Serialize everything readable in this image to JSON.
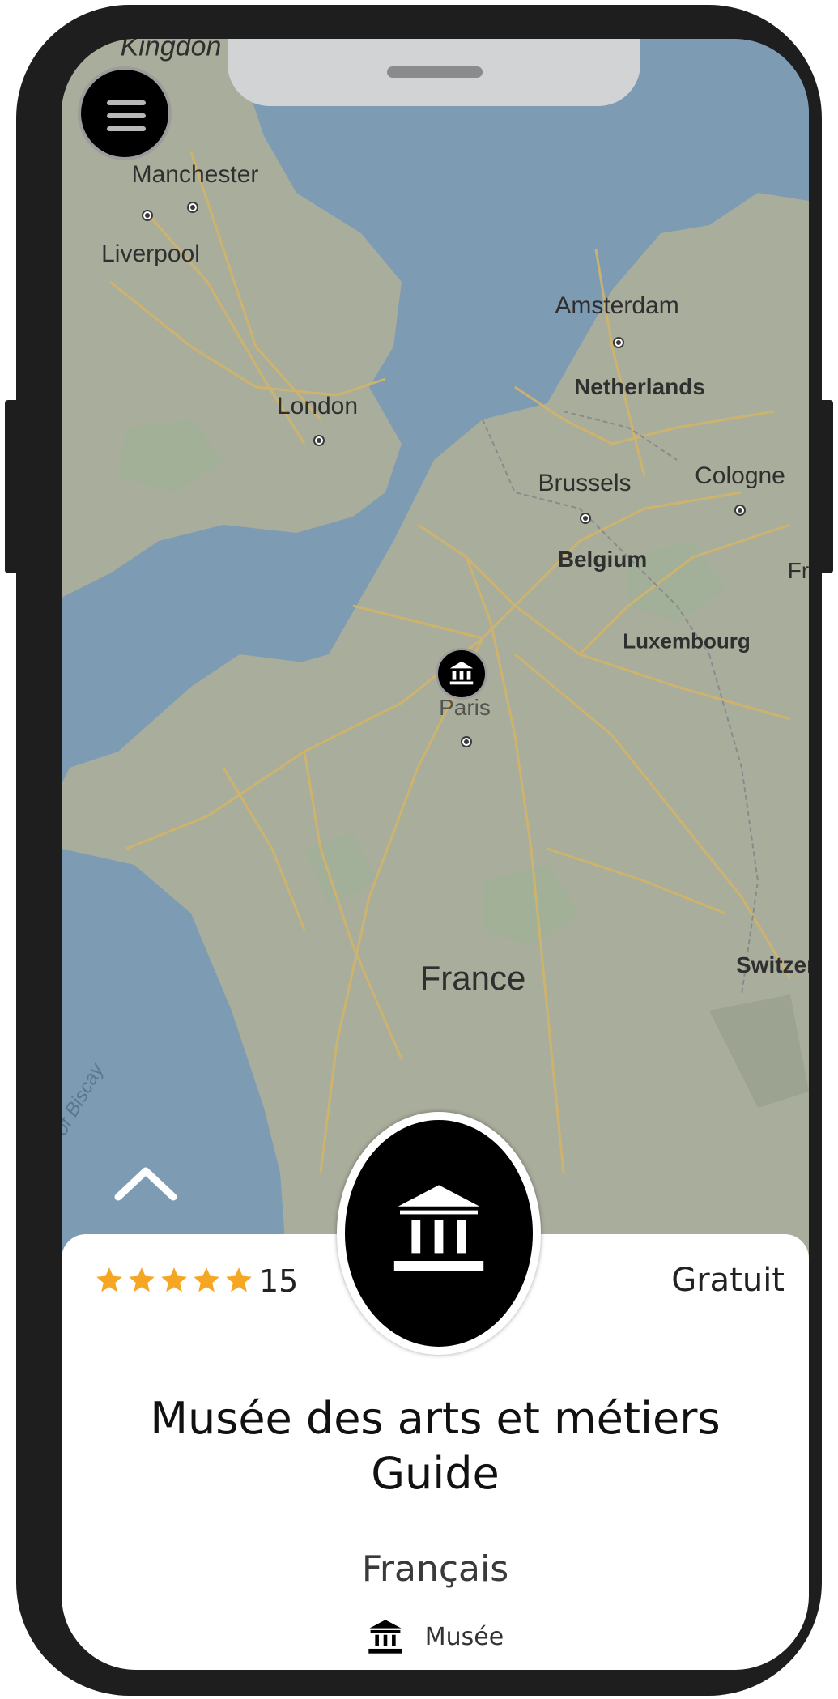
{
  "map": {
    "labels": {
      "kingdom": "Kingdon",
      "manchester": "Manchester",
      "liverpool": "Liverpool",
      "london": "London",
      "amsterdam": "Amsterdam",
      "netherlands": "Netherlands",
      "brussels": "Brussels",
      "cologne": "Cologne",
      "belgium": "Belgium",
      "luxembourg": "Luxembourg",
      "paris": "Paris",
      "france": "France",
      "switzerland": "Switzer",
      "fr_edge": "Fr",
      "biscay": "of Biscay"
    },
    "colors": {
      "sea": "#7e9bb4",
      "land": "#a9ad9c",
      "road": "#d2b46a"
    }
  },
  "icons": {
    "menu": "hamburger-menu-icon",
    "museum": "museum-building-icon",
    "expand": "chevron-up-icon",
    "star": "star-icon"
  },
  "card": {
    "rating_stars": 5,
    "rating_count": "15",
    "price": "Gratuit",
    "title_line1": "Musée des arts et métiers",
    "title_line2": "Guide",
    "language": "Français",
    "category": "Musée",
    "star_color": "#f5a623"
  }
}
